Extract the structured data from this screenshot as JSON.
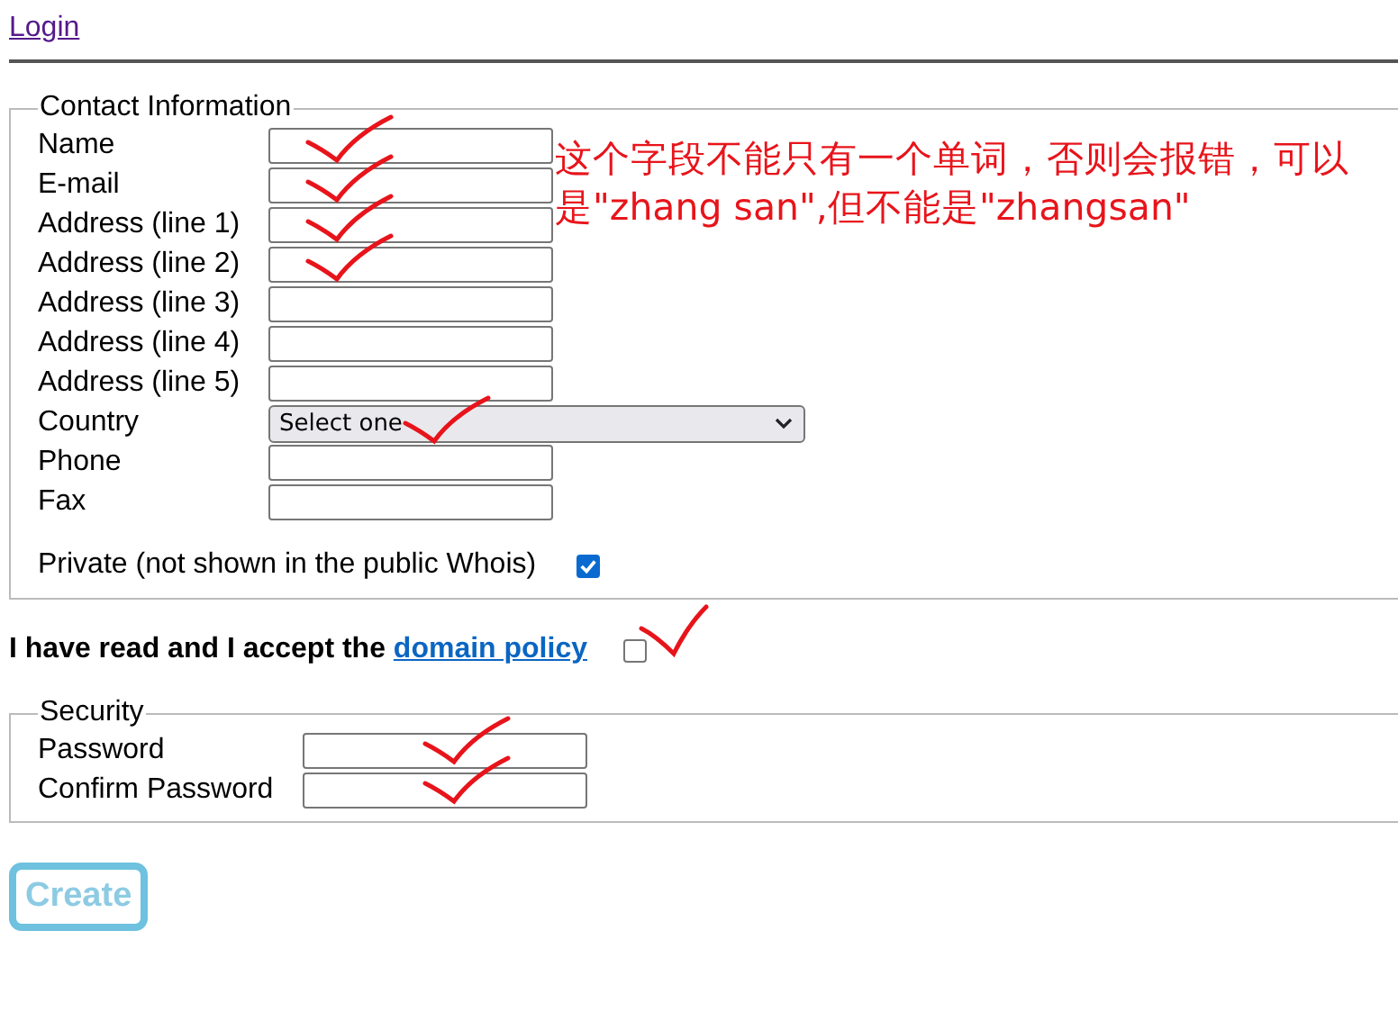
{
  "login_link": "Login",
  "contact": {
    "legend": "Contact Information",
    "note": "这个字段不能只有一个单词，否则会报错，可以是\"zhang san\",但不能是\"zhangsan\"",
    "fields": [
      {
        "kind": "text",
        "label": "Name",
        "ticked": true
      },
      {
        "kind": "text",
        "label": "E-mail",
        "ticked": true
      },
      {
        "kind": "text",
        "label": "Address (line 1)",
        "ticked": true
      },
      {
        "kind": "text",
        "label": "Address (line 2)",
        "ticked": true
      },
      {
        "kind": "text",
        "label": "Address (line 3)",
        "ticked": false
      },
      {
        "kind": "text",
        "label": "Address (line 4)",
        "ticked": false
      },
      {
        "kind": "text",
        "label": "Address (line 5)",
        "ticked": false
      },
      {
        "kind": "select",
        "label": "Country",
        "value": "Select one",
        "ticked": true
      },
      {
        "kind": "text",
        "label": "Phone",
        "ticked": false
      },
      {
        "kind": "text",
        "label": "Fax",
        "ticked": false
      }
    ],
    "private": {
      "label": "Private (not shown in the public Whois)",
      "checked": true
    }
  },
  "policy": {
    "text": "I have read and I accept the ",
    "link": "domain policy",
    "checked": false,
    "ticked": true
  },
  "security": {
    "legend": "Security",
    "fields": [
      {
        "label": "Password",
        "ticked": true
      },
      {
        "label": "Confirm Password",
        "ticked": true
      }
    ]
  },
  "create_button": {
    "label": "Create",
    "disabled": true
  }
}
